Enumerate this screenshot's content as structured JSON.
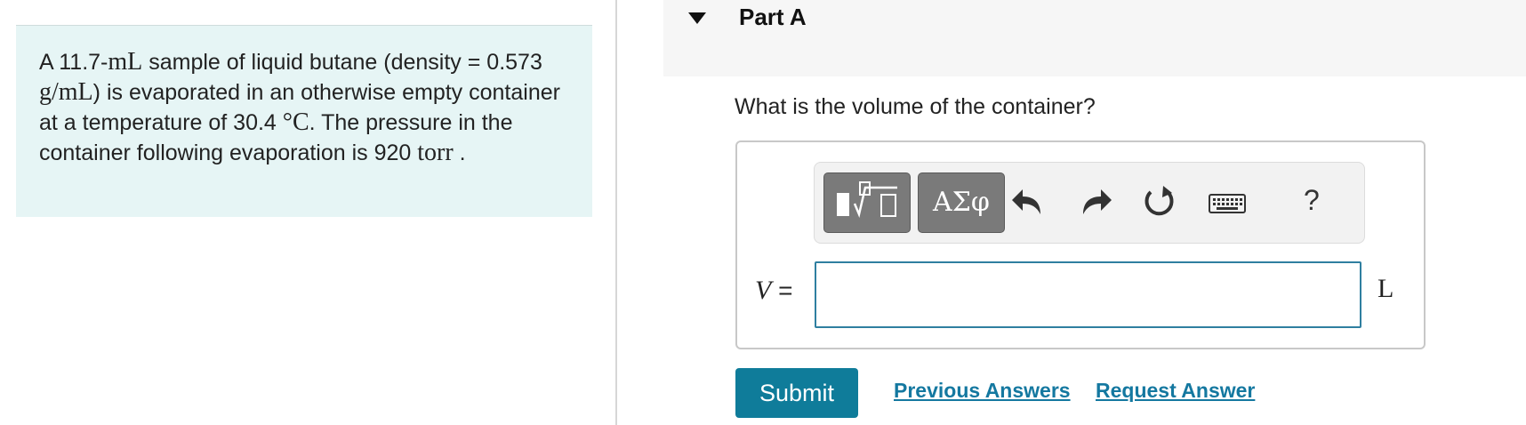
{
  "problem": {
    "text_1": "A 11.7-",
    "unit_ml": "mL",
    "text_2": " sample of liquid butane (density = 0.573 ",
    "unit_gml": "g/mL",
    "text_3": ") is evaporated in an otherwise empty container at a temperature of 30.4 ",
    "unit_c": "°C",
    "text_4": ". The pressure in the container following evaporation is 920 ",
    "unit_torr": "torr",
    "text_5": " ."
  },
  "part": {
    "title": "Part A",
    "question": "What is the volume of the container?"
  },
  "toolbar": {
    "symbols_label": "ΑΣφ",
    "help_label": "?",
    "icons": [
      "templates-icon",
      "undo-icon",
      "redo-icon",
      "reset-icon",
      "keyboard-icon",
      "help-icon"
    ]
  },
  "answer": {
    "variable": "V",
    "equals": "=",
    "value": "",
    "unit": "L"
  },
  "actions": {
    "submit_label": "Submit",
    "previous_answers_label": "Previous Answers",
    "request_answer_label": "Request Answer"
  },
  "colors": {
    "problem_bg": "#e6f5f5",
    "accent": "#0f7c9a",
    "link": "#1478a0",
    "input_border": "#2f7fa0"
  }
}
